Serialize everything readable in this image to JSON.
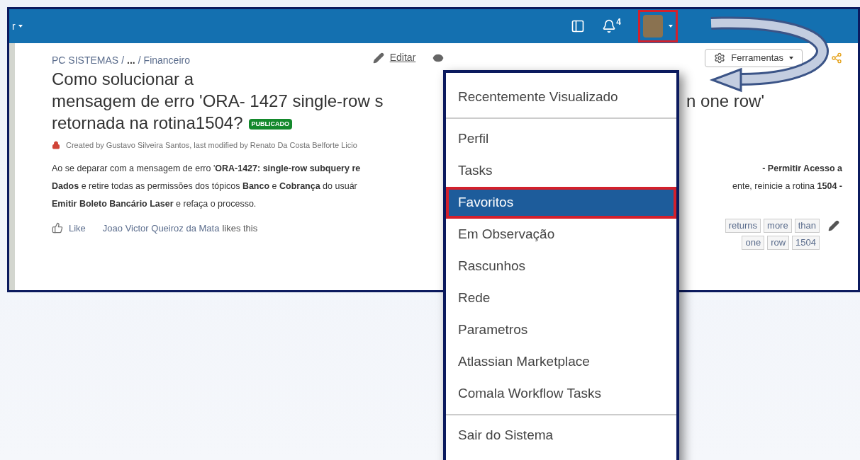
{
  "header": {
    "menu_label": "r",
    "notifications_count": "4",
    "avatar_highlighted": true
  },
  "page": {
    "breadcrumb": [
      "PC SISTEMAS",
      "...",
      "Financeiro"
    ],
    "breadcrumb_separator": "/",
    "actions": [
      {
        "kind": "edit",
        "label": "Editar"
      },
      {
        "kind": "watch"
      }
    ],
    "tools_button": "Ferramentas",
    "title_lines": [
      {
        "left": "Como solucionar a"
      },
      {
        "left": "mensagem de erro 'ORA- 1427 single-row s",
        "right": "n one row'"
      },
      {
        "left": "retornada na rotina1504?"
      }
    ],
    "status_badge": "PUBLICADO",
    "byline": "Created by Gustavo Silveira Santos, last modified by Renato Da Costa Belforte Licio",
    "body_lines": [
      {
        "left": "Ao se deparar com a mensagem de erro '**ORA-1427: single-row subquery re**",
        "right": "**- Permitir Acesso a**"
      },
      {
        "left": "**Dados** e retire todas as permissões dos tópicos **Banco** e **Cobrança** do usuár",
        "right": "ente, reinicie a rotina **1504 -**"
      },
      {
        "left": "**Emitir Boleto Bancário Laser** e refaça o processo."
      }
    ],
    "like_label": "Like",
    "liker": "Joao Victor Queiroz da Mata",
    "likes_suffix": "likes this",
    "labels": [
      [
        "returns",
        "more",
        "than"
      ],
      [
        "one",
        "row",
        "1504"
      ]
    ]
  },
  "menu": {
    "groups": [
      [
        {
          "label": "Recentemente Visualizado",
          "selected": false
        }
      ],
      [
        {
          "label": "Perfil",
          "selected": false
        },
        {
          "label": "Tasks",
          "selected": false
        },
        {
          "label": "Favoritos",
          "selected": true
        },
        {
          "label": "Em Observação",
          "selected": false
        },
        {
          "label": "Rascunhos",
          "selected": false
        },
        {
          "label": "Rede",
          "selected": false
        },
        {
          "label": "Parametros",
          "selected": false
        },
        {
          "label": "Atlassian Marketplace",
          "selected": false
        },
        {
          "label": "Comala Workflow Tasks",
          "selected": false
        }
      ],
      [
        {
          "label": "Sair do Sistema",
          "selected": false
        }
      ]
    ]
  }
}
